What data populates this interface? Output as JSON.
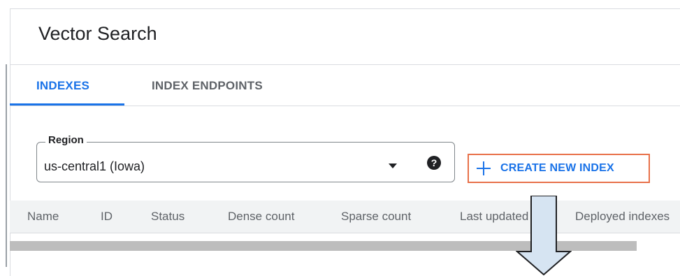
{
  "page": {
    "title": "Vector Search"
  },
  "tabs": [
    {
      "label": "INDEXES",
      "active": true
    },
    {
      "label": "INDEX ENDPOINTS",
      "active": false
    }
  ],
  "region": {
    "label": "Region",
    "value": "us-central1 (Iowa)",
    "help_glyph": "?"
  },
  "create_button": {
    "icon": "plus-icon",
    "label": "CREATE NEW INDEX"
  },
  "table": {
    "columns": [
      "Name",
      "ID",
      "Status",
      "Dense count",
      "Sparse count",
      "Last updated",
      "Deployed indexes"
    ]
  },
  "colors": {
    "accent": "#1a73e8",
    "highlight_box": "#e8714a",
    "arrow_fill": "#d6e4f2",
    "header_bg": "#f1f3f4"
  }
}
